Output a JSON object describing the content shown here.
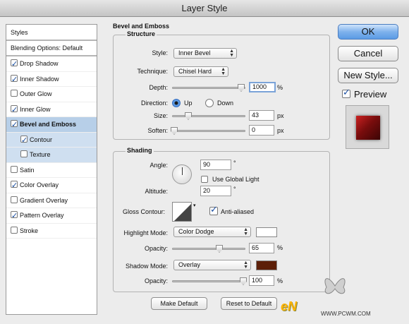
{
  "window": {
    "title": "Layer Style"
  },
  "styles_list": {
    "header": "Styles",
    "blending": "Blending Options: Default",
    "items": [
      {
        "label": "Drop Shadow",
        "checked": true
      },
      {
        "label": "Inner Shadow",
        "checked": true
      },
      {
        "label": "Outer Glow",
        "checked": false
      },
      {
        "label": "Inner Glow",
        "checked": true
      },
      {
        "label": "Bevel and Emboss",
        "checked": true
      },
      {
        "label": "Contour",
        "checked": true
      },
      {
        "label": "Texture",
        "checked": false
      },
      {
        "label": "Satin",
        "checked": false
      },
      {
        "label": "Color Overlay",
        "checked": true
      },
      {
        "label": "Gradient Overlay",
        "checked": false
      },
      {
        "label": "Pattern Overlay",
        "checked": true
      },
      {
        "label": "Stroke",
        "checked": false
      }
    ]
  },
  "panel": {
    "title": "Bevel and Emboss",
    "structure": {
      "label": "Structure",
      "style_label": "Style:",
      "style_value": "Inner Bevel",
      "technique_label": "Technique:",
      "technique_value": "Chisel Hard",
      "depth_label": "Depth:",
      "depth_value": "1000",
      "depth_unit": "%",
      "direction_label": "Direction:",
      "dir_up": "Up",
      "dir_down": "Down",
      "direction_selected": "Up",
      "size_label": "Size:",
      "size_value": "43",
      "size_unit": "px",
      "soften_label": "Soften:",
      "soften_value": "0",
      "soften_unit": "px"
    },
    "shading": {
      "label": "Shading",
      "angle_label": "Angle:",
      "angle_value": "90",
      "angle_unit": "°",
      "global_light_label": "Use Global Light",
      "global_light_checked": false,
      "altitude_label": "Altitude:",
      "altitude_value": "20",
      "altitude_unit": "°",
      "gloss_label": "Gloss Contour:",
      "anti_aliased_label": "Anti-aliased",
      "anti_aliased_checked": true,
      "highlight_mode_label": "Highlight Mode:",
      "highlight_mode_value": "Color Dodge",
      "highlight_color": "#ffffff",
      "h_opacity_label": "Opacity:",
      "h_opacity_value": "65",
      "h_opacity_unit": "%",
      "shadow_mode_label": "Shadow Mode:",
      "shadow_mode_value": "Overlay",
      "shadow_color": "#5c1f08",
      "s_opacity_label": "Opacity:",
      "s_opacity_value": "100",
      "s_opacity_unit": "%"
    },
    "make_default": "Make Default",
    "reset_default": "Reset to Default"
  },
  "buttons": {
    "ok": "OK",
    "cancel": "Cancel",
    "new_style": "New Style..."
  },
  "preview": {
    "label": "Preview",
    "checked": true
  },
  "watermark": {
    "brand": "eN",
    "url": "WWW.PCWM.COM"
  }
}
